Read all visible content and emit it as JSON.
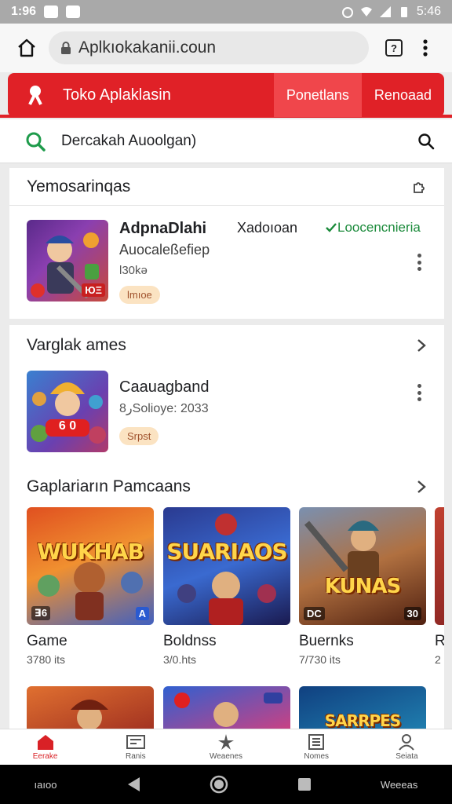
{
  "status_bar": {
    "time": "1:96",
    "right_text": "5:46"
  },
  "browser": {
    "url": "Aplkıokakanii.coun",
    "tabs_count": "?"
  },
  "store_bar": {
    "title": "Toko Aplaklasin",
    "tabs": [
      {
        "label": "Ponetlans"
      },
      {
        "label": "Renoaad"
      }
    ]
  },
  "search": {
    "value": "Dercakah Auoolgan)"
  },
  "card_featured": {
    "heading": "Yemosarinqas",
    "app": {
      "name": "AdpnaDlahi",
      "developer": "Auocaleßefiep",
      "meta": "l30kə",
      "middle_text": "Xadoıoan",
      "rating_text": "Loocencnieria",
      "chip": "lmıoe",
      "thumb_badge": "ЮΞ"
    }
  },
  "card_main": {
    "section1": {
      "heading": "Varglak ames",
      "app": {
        "name": "Caauagband",
        "meta": "ﺭ8Solioye: 2033",
        "chip": "Srpst",
        "art_text": "6 0"
      }
    },
    "section2": {
      "heading": "Gaplariarın Pamcaans",
      "games": [
        {
          "name": "Game",
          "meta": "3780 its",
          "art_text": "WUKHAB",
          "badge_left": "ꓱ6",
          "badge_right": "A"
        },
        {
          "name": "Boldnss",
          "meta": "3/0.hts",
          "art_text": "SUARIAOS",
          "badge_left": "",
          "badge_right": ""
        },
        {
          "name": "Buernks",
          "meta": "7/730 its",
          "art_text": "KUNAS",
          "badge_left": "DC",
          "badge_right": "30"
        },
        {
          "name": "R",
          "meta": "2"
        }
      ]
    },
    "more_art": [
      {
        "art_text": ""
      },
      {
        "art_text": ""
      },
      {
        "art_text": "SARRPES"
      }
    ]
  },
  "bottom_nav": {
    "items": [
      {
        "label": "Eerake",
        "icon": "home-icon"
      },
      {
        "label": "Ranis",
        "icon": "apps-icon"
      },
      {
        "label": "Weaenes",
        "icon": "star-icon"
      },
      {
        "label": "Nomes",
        "icon": "list-icon"
      },
      {
        "label": "Seiata",
        "icon": "person-icon"
      }
    ]
  },
  "system_nav": {
    "left_text": "ıaıoo",
    "right_text": "Weeeas"
  },
  "colors": {
    "accent": "#e02127",
    "accent_light": "#f0464b",
    "rating_green": "#1a8a3a"
  }
}
